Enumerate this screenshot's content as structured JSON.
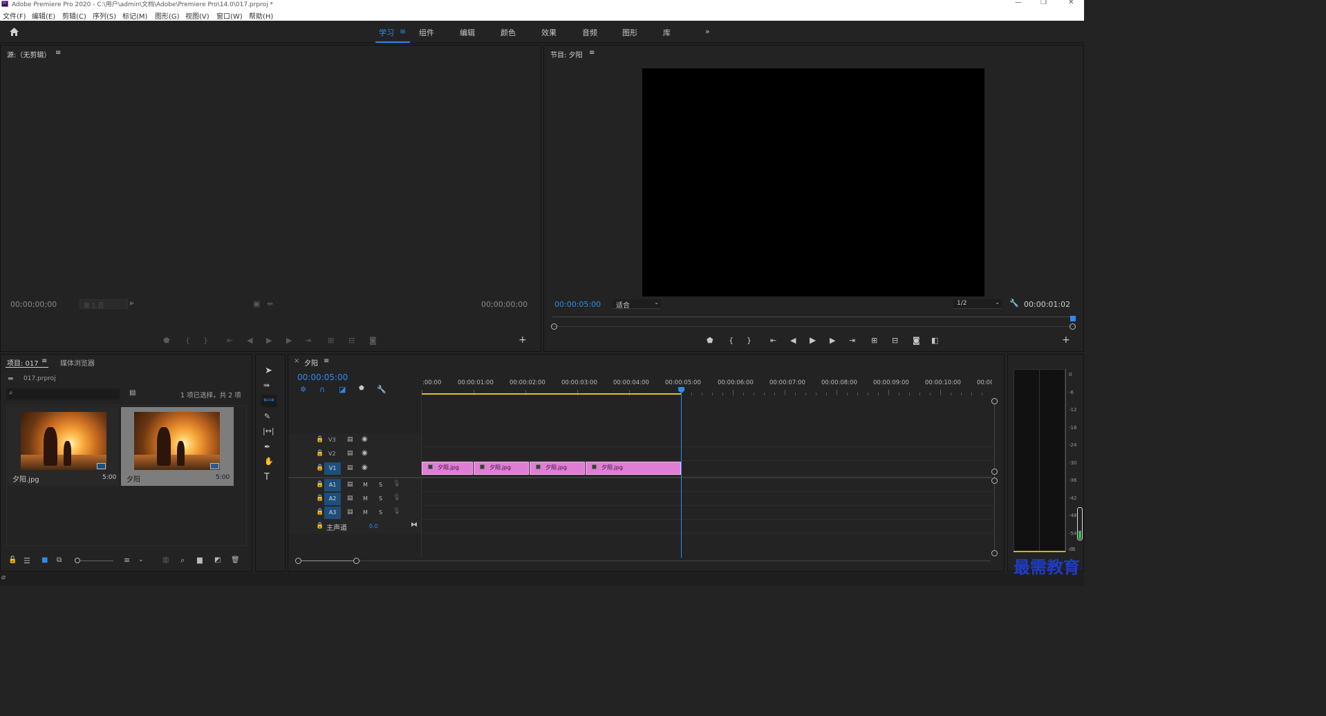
{
  "window": {
    "title": "Adobe Premiere Pro 2020 - C:\\用户\\admin\\文档\\Adobe\\Premiere Pro\\14.0\\017.prproj *",
    "app_logo": "Pr"
  },
  "menu": [
    "文件(F)",
    "编辑(E)",
    "剪辑(C)",
    "序列(S)",
    "标记(M)",
    "图形(G)",
    "视图(V)",
    "窗口(W)",
    "帮助(H)"
  ],
  "workspaces": [
    "学习",
    "组件",
    "编辑",
    "颜色",
    "效果",
    "音频",
    "图形",
    "库"
  ],
  "active_workspace": "学习",
  "source_monitor": {
    "title": "源:（无剪辑）",
    "timecode_left": "00;00;00;00",
    "page_label": "第 1 页",
    "timecode_right": "00;00;00;00"
  },
  "program_monitor": {
    "title": "节目: 夕阳",
    "timecode": "00:00:05:00",
    "zoom": "适合",
    "resolution": "1/2",
    "duration": "00:00:01:02"
  },
  "project_panel": {
    "title": "项目: 017",
    "tab2": "媒体浏览器",
    "file": "017.prproj",
    "selection": "1 项已选择，共 2 项",
    "items": [
      {
        "name": "夕阳.jpg",
        "duration": "5:00"
      },
      {
        "name": "夕阳",
        "duration": "5:00"
      }
    ]
  },
  "timeline": {
    "title": "夕阳",
    "timecode": "00:00:05:00",
    "ruler": [
      ":00:00",
      "00:00:01:00",
      "00:00:02:00",
      "00:00:03:00",
      "00:00:04:00",
      "00:00:05:00",
      "00:00:06:00",
      "00:00:07:00",
      "00:00:08:00",
      "00:00:09:00",
      "00:00:10:00",
      "00:00:0"
    ],
    "video_tracks": [
      "V3",
      "V2",
      "V1"
    ],
    "audio_tracks": [
      "A1",
      "A2",
      "A3"
    ],
    "mute": "M",
    "solo": "S",
    "master": {
      "label": "主声道",
      "value": "0.0"
    },
    "clips": [
      "夕阳.jpg",
      "夕阳.jpg",
      "夕阳.jpg",
      "夕阳.jpg"
    ]
  },
  "audio_meter": {
    "labels": [
      "0",
      "-6",
      "-12",
      "-18",
      "-24",
      "-30",
      "-36",
      "-42",
      "-48",
      "-54",
      "dB"
    ]
  },
  "watermark": "最需教育",
  "colors": {
    "accent": "#2d8ceb",
    "clip": "#e07ed6",
    "track_active": "#1e4f7a",
    "panel_bg": "#232323"
  }
}
